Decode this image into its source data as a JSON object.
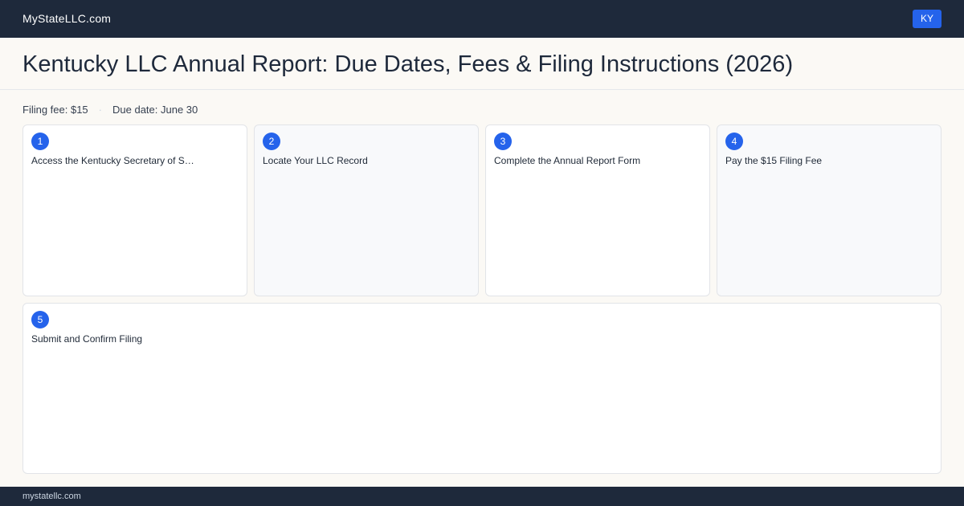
{
  "header": {
    "brand": "MyStateLLC.com",
    "state_badge": "KY"
  },
  "page": {
    "title": "Kentucky LLC Annual Report: Due Dates, Fees & Filing Instructions (2026)"
  },
  "meta": {
    "filing_fee": "Filing fee: $15",
    "separator": "·",
    "due_date": "Due date: June 30"
  },
  "steps": [
    {
      "number": "1",
      "label": "Access the Kentucky Secretary of S…"
    },
    {
      "number": "2",
      "label": "Locate Your LLC Record"
    },
    {
      "number": "3",
      "label": "Complete the Annual Report Form"
    },
    {
      "number": "4",
      "label": "Pay the $15 Filing Fee"
    },
    {
      "number": "5",
      "label": "Submit and Confirm Filing"
    }
  ],
  "footer": {
    "domain": "mystatellc.com"
  },
  "colors": {
    "nav_bg": "#1e293b",
    "accent": "#2563eb",
    "page_bg": "#fbf9f5"
  }
}
